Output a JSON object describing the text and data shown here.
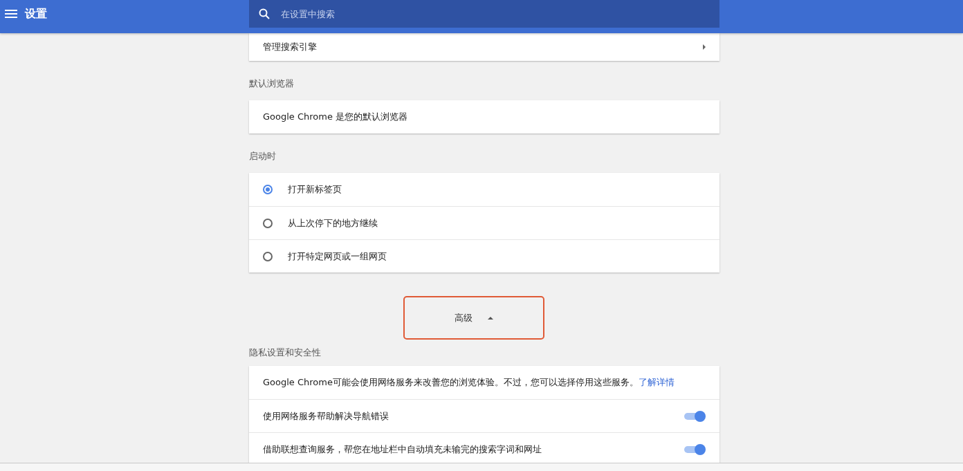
{
  "header": {
    "title": "设置",
    "search_placeholder": "在设置中搜索"
  },
  "top_card": {
    "label": "管理搜索引擎"
  },
  "sections": [
    {
      "heading": "默认浏览器",
      "rows": [
        {
          "kind": "text",
          "label": "Google Chrome 是您的默认浏览器"
        }
      ]
    },
    {
      "heading": "启动时",
      "rows": [
        {
          "kind": "radio",
          "label": "打开新标签页",
          "selected": true
        },
        {
          "kind": "radio",
          "label": "从上次停下的地方继续",
          "selected": false
        },
        {
          "kind": "radio",
          "label": "打开特定网页或一组网页",
          "selected": false
        }
      ]
    }
  ],
  "advanced": {
    "label": "高级",
    "expanded": true
  },
  "privacy": {
    "heading": "隐私设置和安全性",
    "rows": [
      {
        "kind": "text",
        "label": "Google Chrome可能会使用网络服务来改善您的浏览体验。不过，您可以选择停用这些服务。",
        "link": "了解详情"
      },
      {
        "kind": "toggle",
        "label": "使用网络服务帮助解决导航错误",
        "on": true
      },
      {
        "kind": "toggle",
        "label": "借助联想查询服务，帮您在地址栏中自动填充未输完的搜索字词和网址",
        "on": true
      }
    ]
  }
}
